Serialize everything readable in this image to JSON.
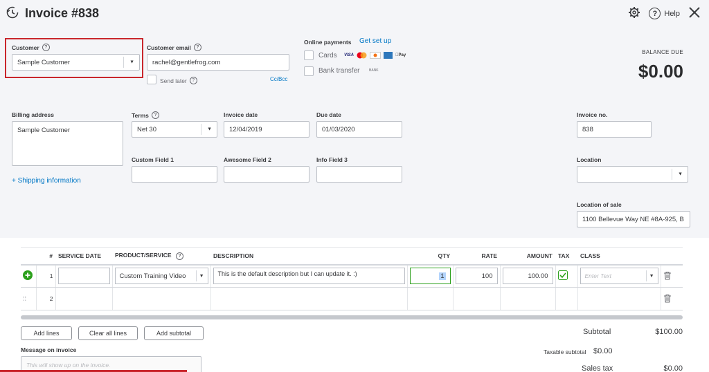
{
  "header": {
    "title": "Invoice #838",
    "help_label": "Help"
  },
  "customer": {
    "label": "Customer",
    "value": "Sample Customer"
  },
  "customer_email": {
    "label": "Customer email",
    "value": "rachel@gentlefrog.com",
    "send_later_label": "Send later",
    "cc_bcc_label": "Cc/Bcc"
  },
  "online_payments": {
    "label": "Online payments",
    "get_set_up_label": "Get set up",
    "cards_label": "Cards",
    "bank_transfer_label": "Bank transfer",
    "card_logos": [
      "VISA",
      "mastercard",
      "DISCOVER",
      "AMEX",
      "Apple Pay"
    ],
    "bank_logo": "BANK"
  },
  "balance": {
    "label": "BALANCE DUE",
    "value": "$0.00"
  },
  "billing": {
    "label": "Billing address",
    "value": "Sample Customer",
    "shipping_link": "+ Shipping information"
  },
  "terms": {
    "label": "Terms",
    "value": "Net 30"
  },
  "invoice_date": {
    "label": "Invoice date",
    "value": "12/04/2019"
  },
  "due_date": {
    "label": "Due date",
    "value": "01/03/2020"
  },
  "invoice_no": {
    "label": "Invoice no.",
    "value": "838"
  },
  "custom_fields": {
    "field1_label": "Custom Field 1",
    "field2_label": "Awesome Field 2",
    "field3_label": "Info Field 3"
  },
  "location": {
    "label": "Location",
    "value": ""
  },
  "location_of_sale": {
    "label": "Location of sale",
    "value": "1100 Bellevue Way NE #8A-925, B"
  },
  "table": {
    "headers": [
      "#",
      "SERVICE DATE",
      "PRODUCT/SERVICE",
      "DESCRIPTION",
      "QTY",
      "RATE",
      "AMOUNT",
      "TAX",
      "CLASS"
    ],
    "rows": [
      {
        "num": "1",
        "service_date": "",
        "product": "Custom Training Video",
        "description": "This is the default description but I can update it. :)",
        "qty": "1",
        "rate": "100",
        "amount": "100.00",
        "class_placeholder": "Enter Text"
      },
      {
        "num": "2"
      }
    ]
  },
  "buttons": {
    "add_lines": "Add lines",
    "clear_all_lines": "Clear all lines",
    "add_subtotal": "Add subtotal"
  },
  "message": {
    "label": "Message on invoice",
    "placeholder": "This will show up on the invoice."
  },
  "totals": {
    "subtotal_label": "Subtotal",
    "subtotal_value": "$100.00",
    "taxable_subtotal_label": "Taxable subtotal",
    "taxable_subtotal_value": "$0.00",
    "sales_tax_label": "Sales tax",
    "sales_tax_value": "$0.00"
  },
  "colors": {
    "accent": "#0077c5",
    "highlight": "#c9262c",
    "success": "#2ca01c"
  }
}
